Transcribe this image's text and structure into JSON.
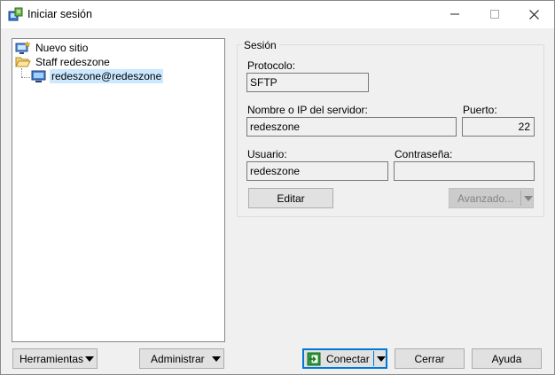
{
  "window": {
    "title": "Iniciar sesión"
  },
  "tree": {
    "items": [
      {
        "label": "Nuevo sitio",
        "icon": "new-site-icon"
      },
      {
        "label": "Staff redeszone",
        "icon": "folder-icon"
      },
      {
        "label": "redeszone@redeszone",
        "icon": "computer-icon",
        "selected": true
      }
    ]
  },
  "session": {
    "legend": "Sesión",
    "protocol_label": "Protocolo:",
    "protocol_value": "SFTP",
    "host_label": "Nombre o IP del servidor:",
    "host_value": "redeszone",
    "port_label": "Puerto:",
    "port_value": "22",
    "user_label": "Usuario:",
    "user_value": "redeszone",
    "password_label": "Contraseña:",
    "password_value": "",
    "edit_button": "Editar",
    "advanced_button": "Avanzado..."
  },
  "footer": {
    "tools_button": "Herramientas",
    "manage_button": "Administrar",
    "connect_button": "Conectar",
    "close_button": "Cerrar",
    "help_button": "Ayuda"
  },
  "colors": {
    "selection": "#cce8ff",
    "primary_border": "#0078d7"
  }
}
